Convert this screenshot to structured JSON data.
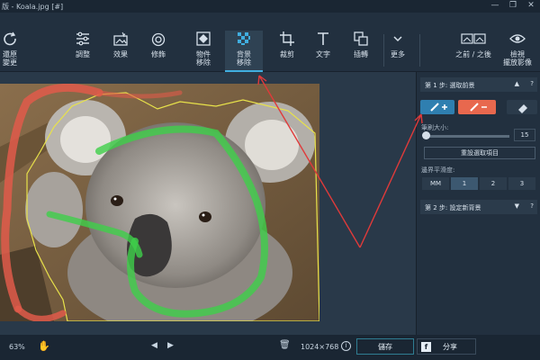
{
  "window": {
    "title": "版 - Koala.jpg [#]",
    "controls": [
      "—",
      "❐",
      "✕"
    ]
  },
  "toolbar": {
    "left": "還原\n變更",
    "items": [
      {
        "label": "調整",
        "icon": "sliders-icon"
      },
      {
        "label": "效果",
        "icon": "magic-image-icon"
      },
      {
        "label": "修飾",
        "icon": "retouch-icon"
      },
      {
        "label": "物件\n移除",
        "icon": "object-removal-icon"
      },
      {
        "label": "背景\n移除",
        "icon": "background-removal-icon",
        "active": true
      },
      {
        "label": "裁剪",
        "icon": "crop-icon"
      },
      {
        "label": "文字",
        "icon": "text-icon"
      },
      {
        "label": "插轉",
        "icon": "layers-icon"
      },
      {
        "label": "更多",
        "icon": "chevron-down-icon"
      }
    ],
    "before_after": "之前 / 之後",
    "preview": "檢視\n擺放影像"
  },
  "panel": {
    "step1": "第 1 步: 選取前景",
    "brush_size_label": "筆刷大小:",
    "brush_size_value": "15",
    "reset_button": "重設選取項目",
    "edge_label": "邊界平滑度:",
    "smooth_options": [
      "MM",
      "1",
      "2",
      "3"
    ],
    "step2": "第 2 步: 設定新背景"
  },
  "status": {
    "zoom": "63%",
    "dimensions": "1024×768",
    "save": "儲存",
    "share": "分享"
  },
  "colors": {
    "accent": "#40aee0",
    "foreground_brush": "#2f7fb0",
    "background_brush": "#e8684e",
    "save_border": "#2f7d92"
  }
}
